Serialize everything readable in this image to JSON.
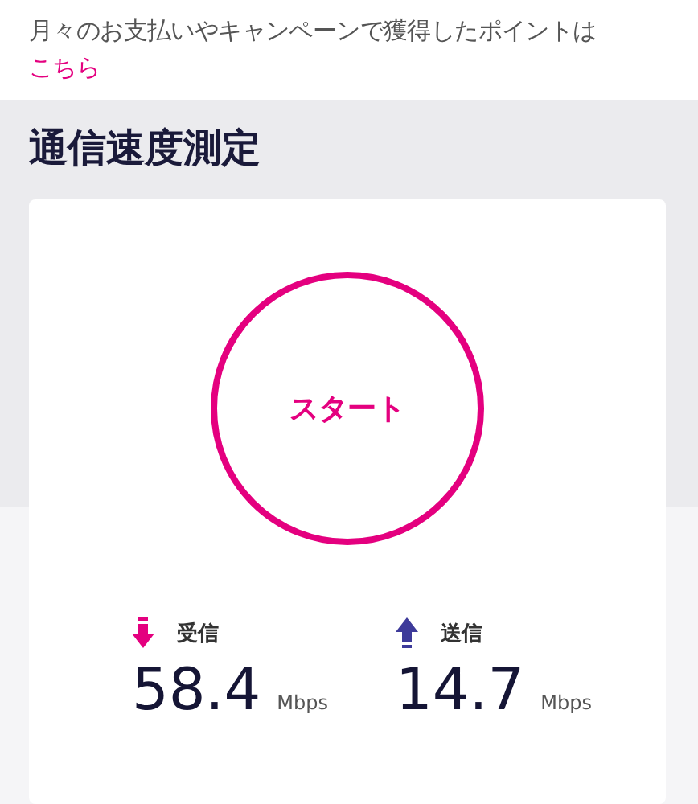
{
  "notice": {
    "text": "月々のお支払いやキャンペーンで獲得したポイントは",
    "link": "こちら"
  },
  "section_title": "通信速度測定",
  "speed_test": {
    "start_button": "スタート",
    "results": [
      {
        "kind": "download",
        "label": "受信",
        "value": "58.4",
        "unit": "Mbps"
      },
      {
        "kind": "upload",
        "label": "送信",
        "value": "14.7",
        "unit": "Mbps"
      }
    ]
  }
}
